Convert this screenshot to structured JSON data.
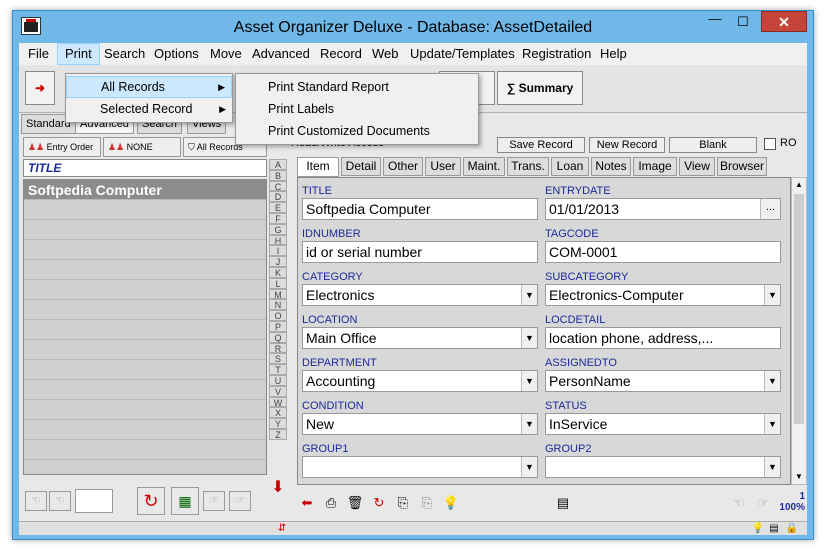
{
  "window": {
    "title": "Asset Organizer Deluxe - Database: AssetDetailed",
    "close_label": "✕",
    "min_label": "—",
    "max_label": "☐"
  },
  "menu": [
    "File",
    "Print",
    "Search",
    "Options",
    "Move",
    "Advanced",
    "Record",
    "Web",
    "Update/Templates",
    "Registration",
    "Help"
  ],
  "print_menu": {
    "items": [
      "All Records",
      "Selected Record"
    ],
    "submenu": [
      "Print Standard Report",
      "Print Labels",
      "Print Customized Documents"
    ]
  },
  "toolbar": {
    "sort_label": "Sort",
    "summary_label": "Summary"
  },
  "left_tabs": [
    "Standard",
    "Advanced",
    "Search",
    "Views"
  ],
  "sort_buttons": [
    "Entry Order",
    "NONE",
    "All Records"
  ],
  "list": {
    "header": "TITLE",
    "selected_item": "Softpedia Computer"
  },
  "alphabet": [
    "A",
    "B",
    "C",
    "D",
    "E",
    "F",
    "G",
    "H",
    "I",
    "J",
    "K",
    "L",
    "M",
    "N",
    "O",
    "P",
    "Q",
    "R",
    "S",
    "T",
    "U",
    "V",
    "W",
    "X",
    "Y",
    "Z"
  ],
  "record_bar": {
    "access_label": "Read/Write Access",
    "save": "Save Record",
    "new": "New Record",
    "blank": "Blank",
    "ro": "RO"
  },
  "detail_tabs": [
    "Item",
    "Detail",
    "Other",
    "User",
    "Maint.",
    "Trans.",
    "Loan",
    "Notes",
    "Image",
    "View",
    "Browser"
  ],
  "fields": [
    {
      "label": "TITLE",
      "value": "Softpedia Computer",
      "kind": "text"
    },
    {
      "label": "ENTRYDATE",
      "value": "01/01/2013",
      "kind": "date"
    },
    {
      "label": "IDNUMBER",
      "value": "id or serial number",
      "kind": "text"
    },
    {
      "label": "TAGCODE",
      "value": "COM-0001",
      "kind": "text"
    },
    {
      "label": "CATEGORY",
      "value": "Electronics",
      "kind": "dropdown"
    },
    {
      "label": "SUBCATEGORY",
      "value": "Electronics-Computer",
      "kind": "dropdown"
    },
    {
      "label": "LOCATION",
      "value": "Main Office",
      "kind": "dropdown"
    },
    {
      "label": "LOCDETAIL",
      "value": "location phone, address,...",
      "kind": "text"
    },
    {
      "label": "DEPARTMENT",
      "value": "Accounting",
      "kind": "dropdown"
    },
    {
      "label": "ASSIGNEDTO",
      "value": "PersonName",
      "kind": "dropdown"
    },
    {
      "label": "CONDITION",
      "value": "New",
      "kind": "dropdown"
    },
    {
      "label": "STATUS",
      "value": "InService",
      "kind": "dropdown"
    },
    {
      "label": "GROUP1",
      "value": "",
      "kind": "dropdown"
    },
    {
      "label": "GROUP2",
      "value": "",
      "kind": "dropdown"
    }
  ],
  "date_button_label": "...",
  "record_count": "1",
  "zoom": "100%"
}
